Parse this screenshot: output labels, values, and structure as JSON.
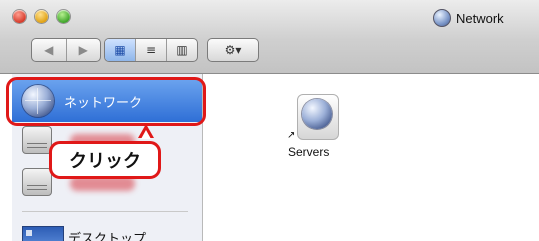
{
  "window": {
    "title": "Network"
  },
  "toolbar": {
    "nav": {
      "back_glyph": "◀",
      "forward_glyph": "▶"
    },
    "view": {
      "icons_glyph": "▦",
      "list_glyph": "≡",
      "columns_glyph": "▥",
      "selected": "icons"
    },
    "action": {
      "glyph": "⚙▾"
    }
  },
  "sidebar": {
    "items": [
      {
        "label": "ネットワーク",
        "icon": "network-globe-icon",
        "selected": true
      },
      {
        "label": "",
        "icon": "hard-drive-icon"
      },
      {
        "label": "",
        "icon": "hard-drive-icon"
      },
      {
        "label": "デスクトップ",
        "icon": "desktop-icon"
      }
    ]
  },
  "annotation": {
    "callout_text": "クリック",
    "color": "#e01818"
  },
  "content": {
    "items": [
      {
        "label": "Servers",
        "icon": "network-globe-icon",
        "alias_glyph": "↗"
      }
    ]
  }
}
